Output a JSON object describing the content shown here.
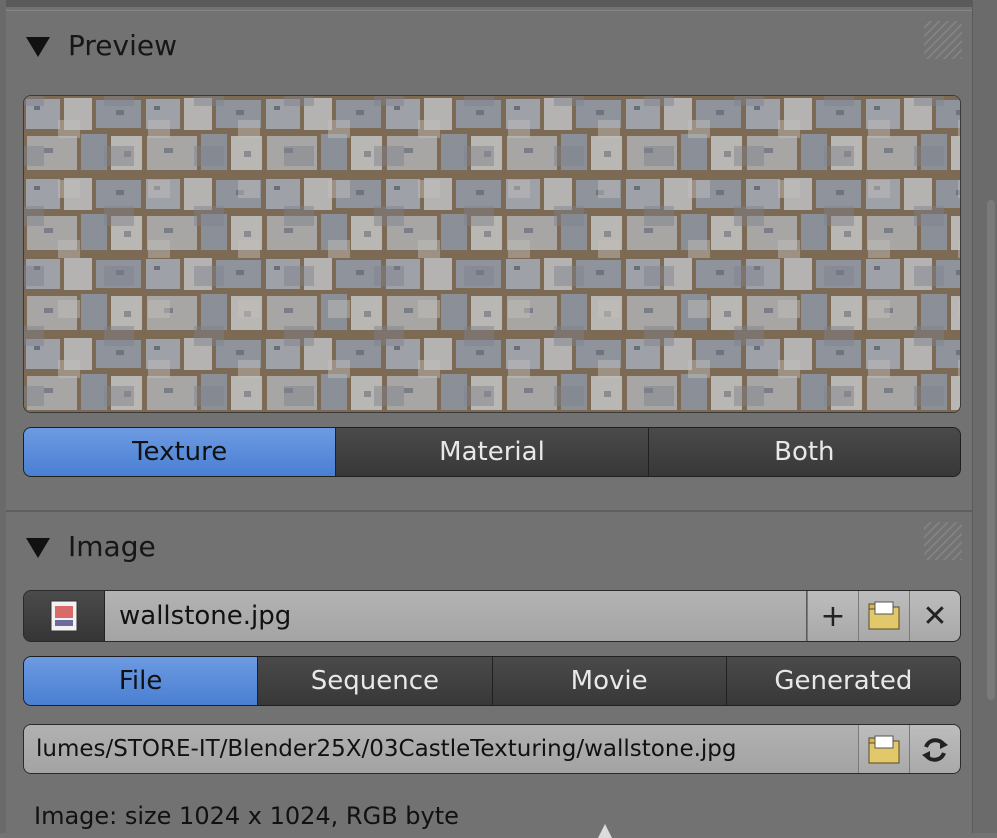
{
  "preview_panel": {
    "title": "Preview",
    "modes": [
      "Texture",
      "Material",
      "Both"
    ],
    "active_mode": "Texture"
  },
  "image_panel": {
    "title": "Image",
    "image_name": "wallstone.jpg",
    "source_tabs": [
      "File",
      "Sequence",
      "Movie",
      "Generated"
    ],
    "active_source": "File",
    "filepath": "lumes/STORE-IT/Blender25X/03CastleTexturing/wallstone.jpg",
    "info": "Image: size 1024 x 1024, RGB byte"
  },
  "icons": {
    "image_type": "image-icon",
    "new": "plus-icon",
    "open": "folder-icon",
    "unlink": "x-icon",
    "browse": "folder-icon",
    "reload": "reload-icon"
  },
  "colors": {
    "panel_bg": "#727272",
    "active_blue": "#5a8ad8",
    "dark_button": "#3d3d3d",
    "field_bg": "#aaaaaa"
  }
}
